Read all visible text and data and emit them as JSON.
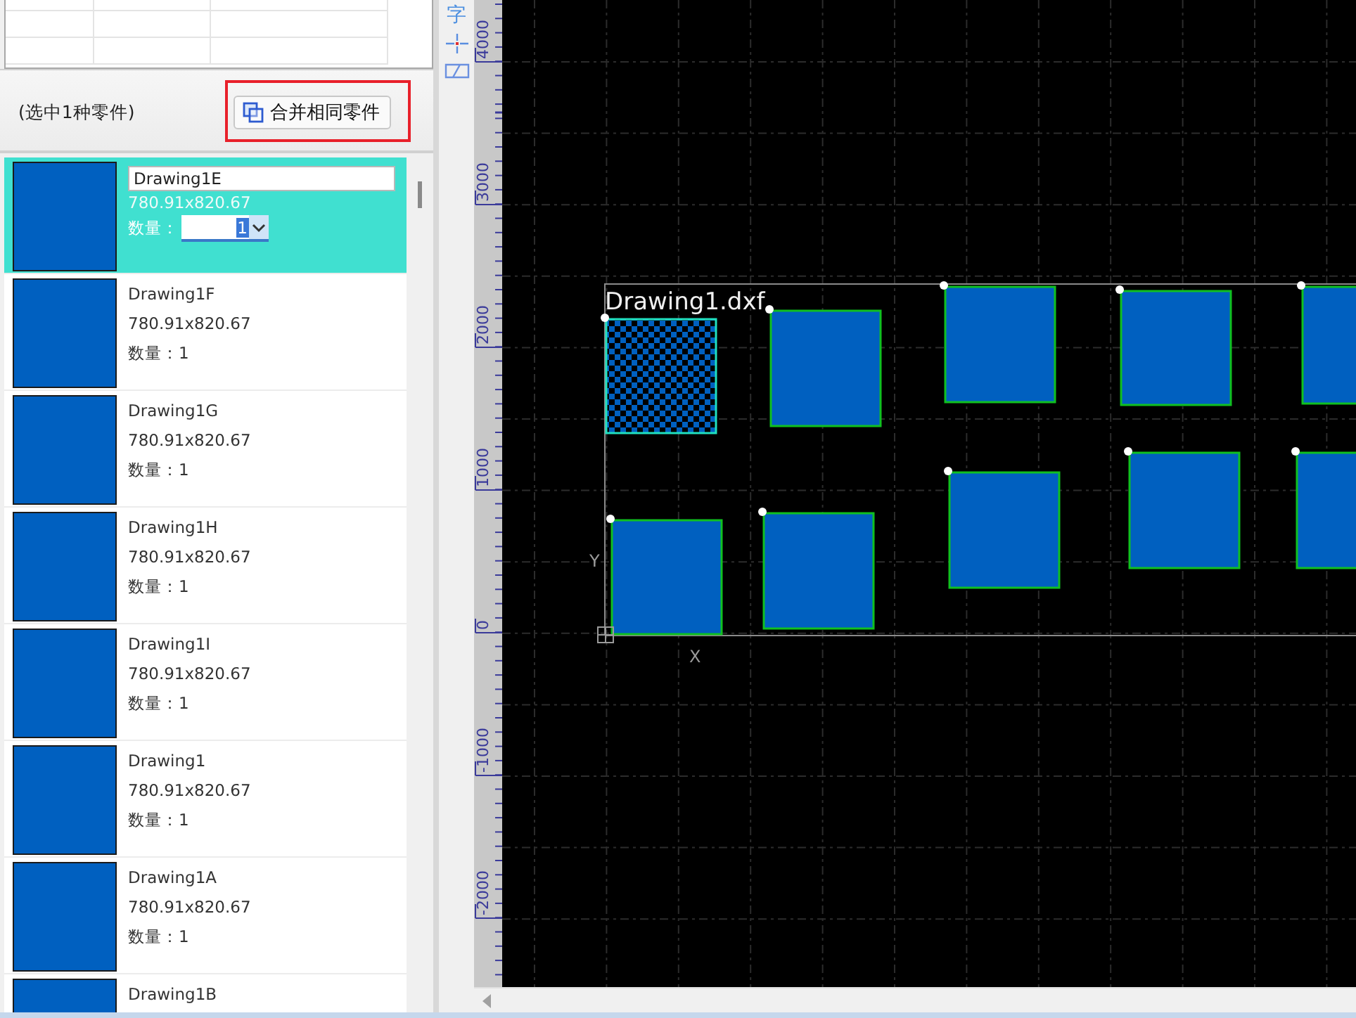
{
  "panel": {
    "selection_info": "(选中1种零件)",
    "merge_button": "合并相同零件"
  },
  "items": [
    {
      "name": "Drawing1E",
      "size": "780.91x820.67",
      "qty_label": "数量：",
      "qty": "1",
      "selected": true
    },
    {
      "name": "Drawing1F",
      "size": "780.91x820.67",
      "qty_label": "数量：",
      "qty": "1",
      "selected": false
    },
    {
      "name": "Drawing1G",
      "size": "780.91x820.67",
      "qty_label": "数量：",
      "qty": "1",
      "selected": false
    },
    {
      "name": "Drawing1H",
      "size": "780.91x820.67",
      "qty_label": "数量：",
      "qty": "1",
      "selected": false
    },
    {
      "name": "Drawing1I",
      "size": "780.91x820.67",
      "qty_label": "数量：",
      "qty": "1",
      "selected": false
    },
    {
      "name": "Drawing1",
      "size": "780.91x820.67",
      "qty_label": "数量：",
      "qty": "1",
      "selected": false
    },
    {
      "name": "Drawing1A",
      "size": "780.91x820.67",
      "qty_label": "数量：",
      "qty": "1",
      "selected": false
    },
    {
      "name": "Drawing1B",
      "selected": false
    }
  ],
  "tools": {
    "text_tool": "字"
  },
  "ruler": {
    "labels": [
      "4000",
      "3000",
      "2000",
      "1000",
      "0",
      "-1000",
      "-2000"
    ]
  },
  "canvas": {
    "file_label": "Drawing1.dxf",
    "x_axis": "X",
    "y_axis": "Y",
    "parts": [
      {
        "selected": true
      },
      {
        "selected": false
      },
      {
        "selected": false
      },
      {
        "selected": false
      },
      {
        "selected": false
      },
      {
        "selected": false
      },
      {
        "selected": false
      },
      {
        "selected": false
      },
      {
        "selected": false
      },
      {
        "selected": false
      }
    ]
  }
}
